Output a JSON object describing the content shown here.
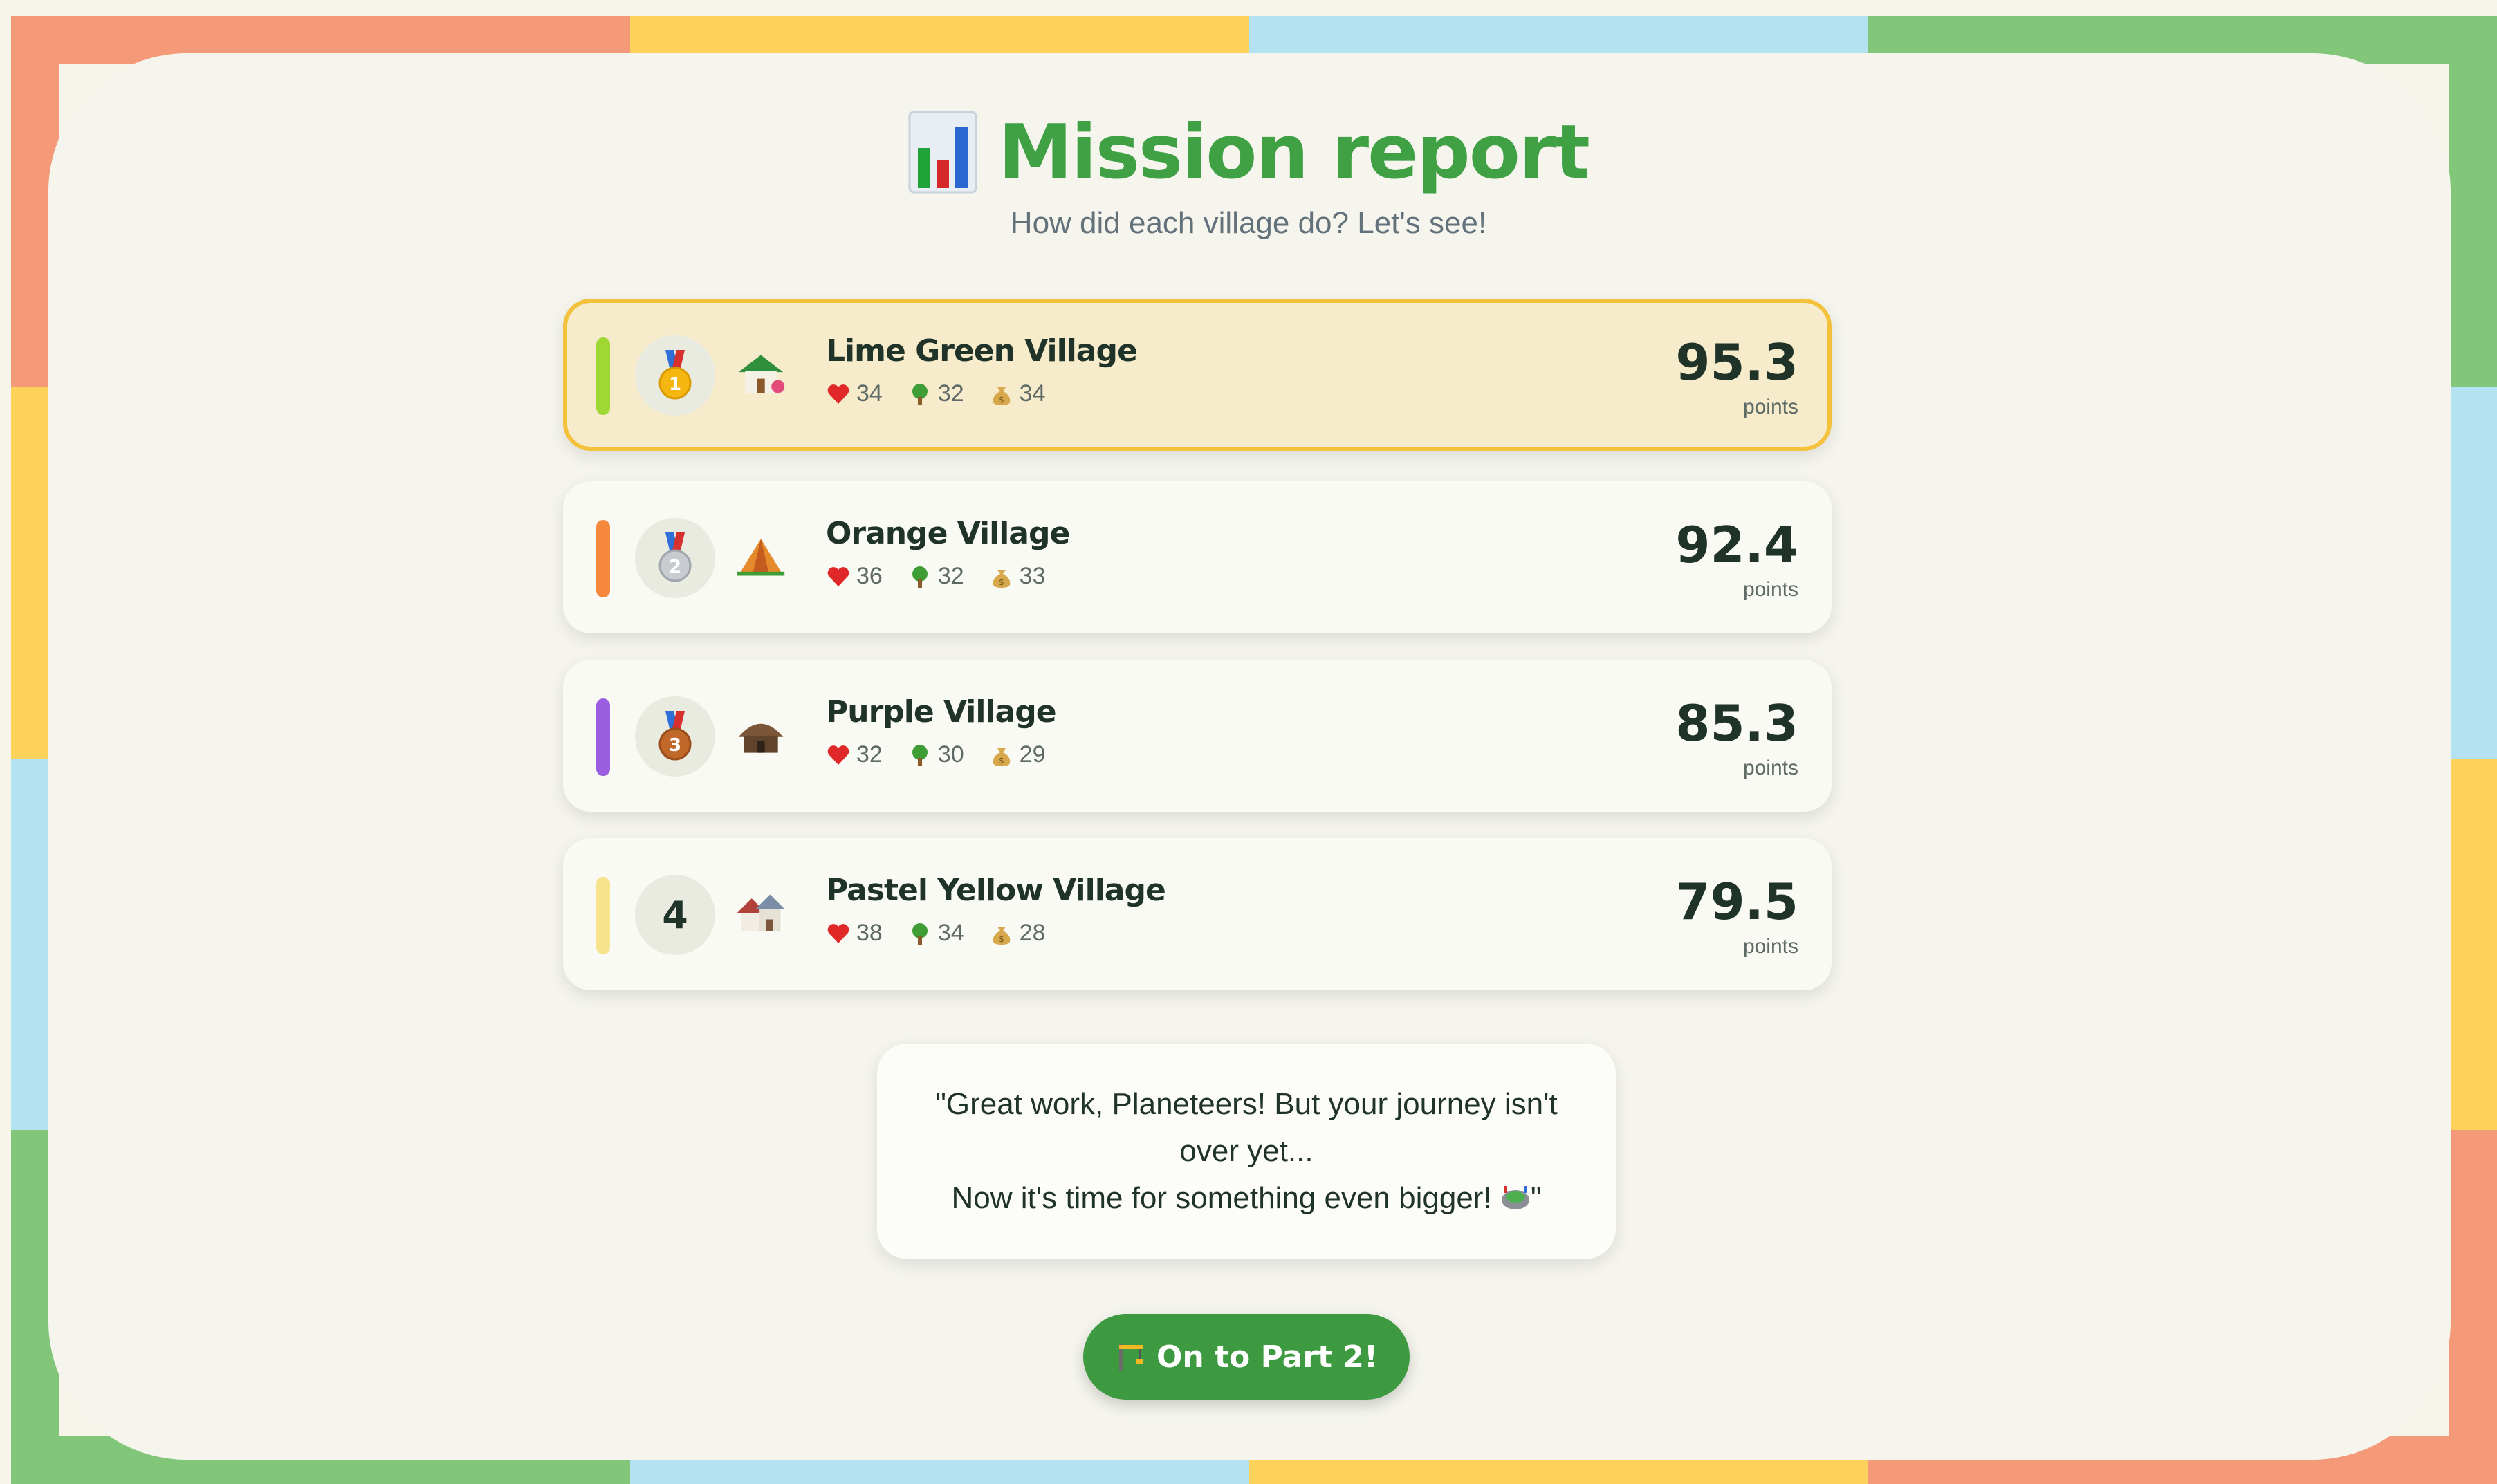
{
  "colors": {
    "frame_salmon": "#f49a78",
    "frame_yellow": "#fcd25a",
    "frame_blue": "#b4e2f0",
    "frame_green": "#82c67a",
    "title_green": "#3fa143",
    "button_green": "#3d9a40",
    "highlight_border": "#f3c13c"
  },
  "header": {
    "icon": "bar-chart-icon",
    "title": "Mission report",
    "subtitle": "How did each village do? Let's see!"
  },
  "villages": [
    {
      "rank": "1",
      "rank_icon": "gold-medal-icon",
      "house_icon": "house-with-garden-icon",
      "name": "Lime Green Village",
      "hearts": "34",
      "trees": "32",
      "money": "34",
      "score": "95.3",
      "unit": "points",
      "bar_color": "#9fd832"
    },
    {
      "rank": "2",
      "rank_icon": "silver-medal-icon",
      "house_icon": "tent-icon",
      "name": "Orange Village",
      "hearts": "36",
      "trees": "32",
      "money": "33",
      "score": "92.4",
      "unit": "points",
      "bar_color": "#f5883c"
    },
    {
      "rank": "3",
      "rank_icon": "bronze-medal-icon",
      "house_icon": "hut-icon",
      "name": "Purple Village",
      "hearts": "32",
      "trees": "30",
      "money": "29",
      "score": "85.3",
      "unit": "points",
      "bar_color": "#9a5fe0"
    },
    {
      "rank": "4",
      "rank_icon": "rank-number",
      "house_icon": "houses-icon",
      "name": "Pastel Yellow Village",
      "hearts": "38",
      "trees": "34",
      "money": "28",
      "score": "79.5",
      "unit": "points",
      "bar_color": "#f7e38c"
    }
  ],
  "stat_icons": {
    "hearts": "heart-icon",
    "trees": "tree-icon",
    "money": "money-bag-icon"
  },
  "quote": {
    "line1": "\"Great work, Planeteers! But your journey isn't over yet...",
    "line2": "Now it's time for something even bigger!",
    "end_mark": "\"",
    "icon": "stadium-icon"
  },
  "next_button": {
    "icon": "construction-icon",
    "label": "On to Part 2!"
  }
}
